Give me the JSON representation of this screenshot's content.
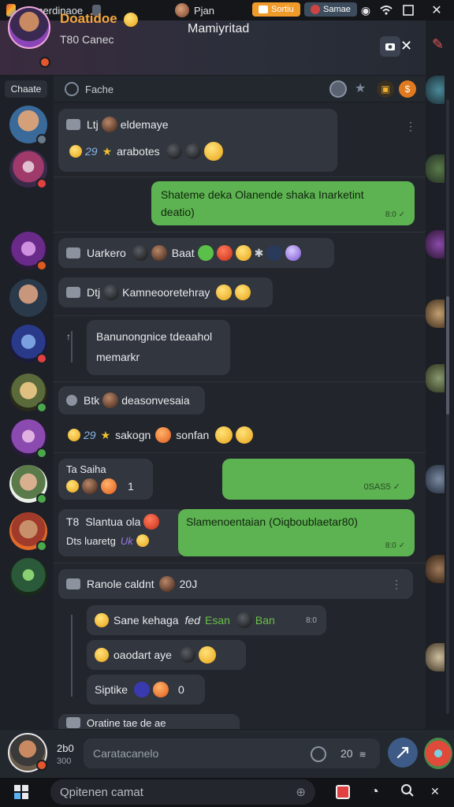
{
  "system_bar": {
    "app_name": "Gamerdinaoe",
    "user_name": "Pjan",
    "pill1_label": "Sortiu",
    "pill2_label": "Samae"
  },
  "header": {
    "title": "Doatidoe",
    "subtitle": "T80 Canec",
    "center_title": "Mamiyritad"
  },
  "subheader": {
    "tab_label": "Chaate",
    "search_label": "Fache"
  },
  "messages": {
    "m1_user": "Ltj",
    "m1_text": "eldemaye",
    "m1_line2_prefix": "29",
    "m1_line2_text": "arabotes",
    "m2_text": "Shateme deka Olanende shaka Inarketint deatio)",
    "m2_time": "8:0",
    "m3_text1": "Uarkero",
    "m3_text2": "Baat",
    "m4_prefix": "Dtj",
    "m4_text": "Kamneooretehray",
    "m5_text": "Banunongnice tdeaahol memarkr",
    "m6_prefix": "Btk",
    "m6_text": "deasonvesaia",
    "m6_line2_prefix": "29",
    "m6_line2_text1": "sakogn",
    "m6_line2_text2": "sonfan",
    "m7_title": "Ta Saiha",
    "m7_count": "1",
    "m8_meta": "0SAS5",
    "m9_prefix": "T8",
    "m9_text": "Slantua ola",
    "m9_line2": "Dts luaretg",
    "m9_line2_tag": "Uk",
    "m10_text": "Slamenoentaian (Oiqboublaetar80)",
    "m10_time": "8:0",
    "m11_text": "Ranole caldnt",
    "m11_number": "20J",
    "m12_text": "Sane kehaga",
    "m12_highlight1": "fed",
    "m12_highlight2": "Esan",
    "m12_highlight3": "Ban",
    "m12_meta": "8:0",
    "m13_text": "oaodart aye",
    "m14_text": "Siptike",
    "m14_count": "0",
    "m15_text": "Oratine tae de ae"
  },
  "input": {
    "left_num": "2b0",
    "left_sub": "300",
    "placeholder": "Caratacanelo",
    "counter": "20"
  },
  "taskbar": {
    "search_placeholder": "Qpitenen camat"
  },
  "colors": {
    "accent_orange": "#f4a640",
    "bubble_green": "#5db351",
    "bubble_dark": "#32363e",
    "send_blue": "#3d5b86"
  }
}
